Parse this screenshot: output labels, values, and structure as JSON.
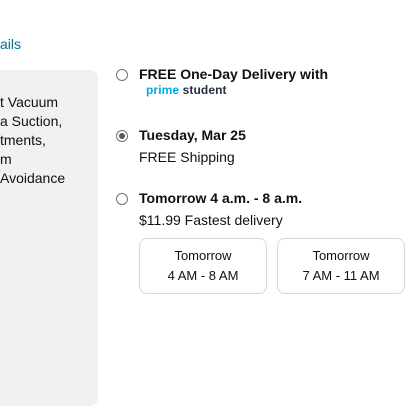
{
  "details_link": "ails",
  "product": {
    "lines": [
      "t Vacuum",
      "a Suction,",
      "tments,",
      "m",
      "Avoidance"
    ]
  },
  "delivery_options": {
    "one_day": {
      "title": "FREE One-Day Delivery with",
      "logo_prime": "prime",
      "logo_student": "student"
    },
    "standard": {
      "title": "Tuesday, Mar 25",
      "subtitle": "FREE Shipping",
      "selected": true
    },
    "fastest": {
      "title": "Tomorrow 4 a.m. - 8 a.m.",
      "subtitle": "$11.99 Fastest delivery",
      "slots": [
        {
          "day": "Tomorrow",
          "time": "4 AM - 8 AM"
        },
        {
          "day": "Tomorrow",
          "time": "7 AM - 11 AM"
        }
      ]
    }
  },
  "colors": {
    "link": "#007185",
    "prime_blue": "#00a8e1",
    "prime_dark": "#232f3e",
    "card_bg": "#f0f2f2"
  }
}
